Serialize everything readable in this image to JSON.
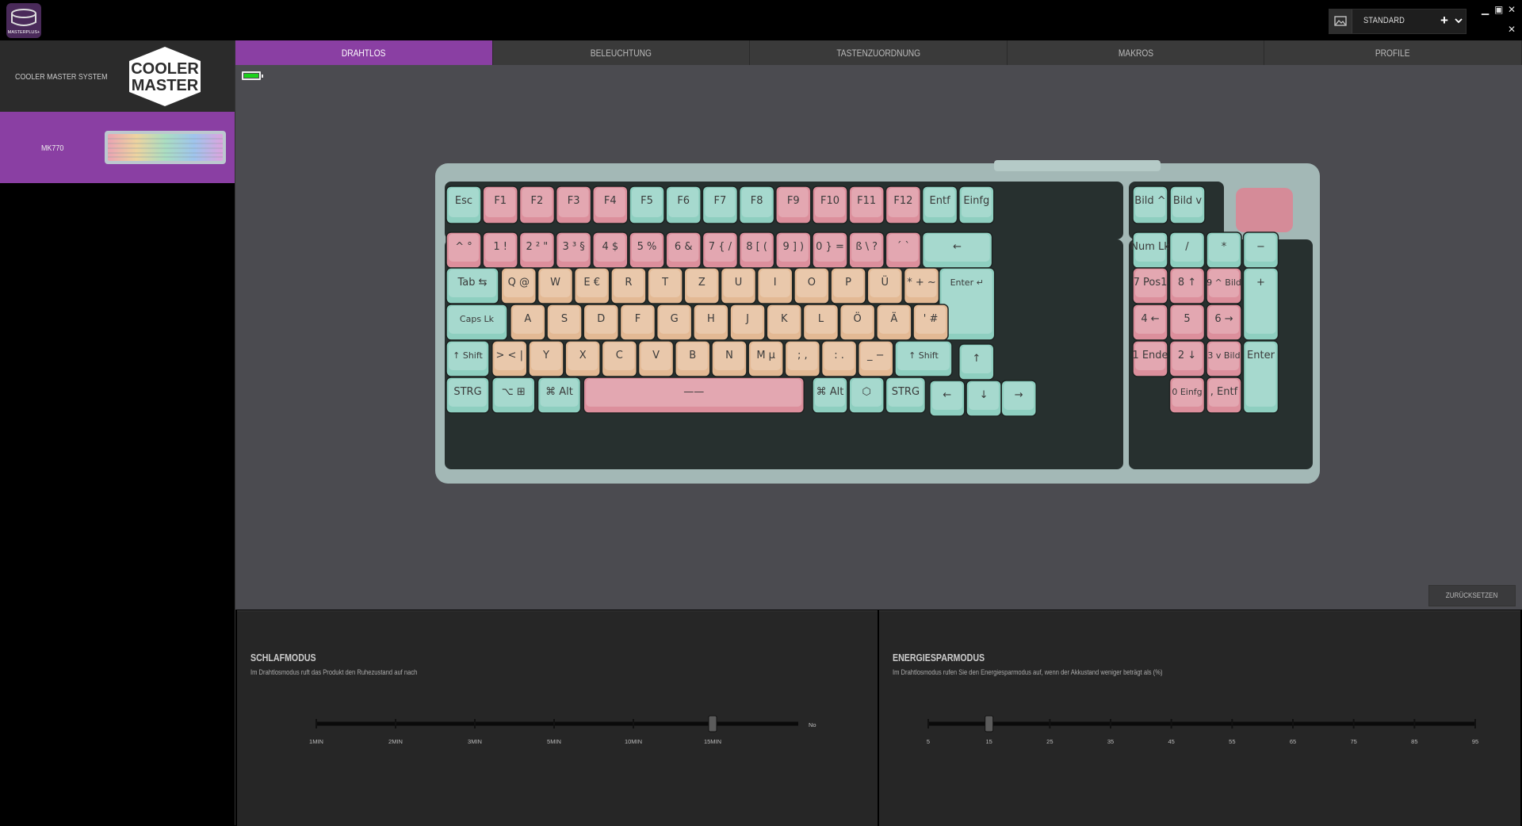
{
  "app": {
    "logo_text": "MASTERPLUS+",
    "profile": {
      "name": "STANDARD",
      "add_label": "+"
    },
    "window_controls": {
      "minimize": "▁",
      "maximize": "▣",
      "close": "✕",
      "exit": "✕"
    }
  },
  "sidebar": {
    "system_label": "COOLER MASTER SYSTEM",
    "logo_text": [
      "COOLER",
      "MASTER"
    ],
    "device_label": "MK770"
  },
  "tabs": [
    {
      "label": "DRAHTLOS",
      "active": true
    },
    {
      "label": "BELEUCHTUNG",
      "active": false
    },
    {
      "label": "TASTENZUORDNUNG",
      "active": false
    },
    {
      "label": "MAKROS",
      "active": false
    },
    {
      "label": "PROFILE",
      "active": false
    }
  ],
  "battery": {
    "level": 1.0,
    "color": "#1bd11b"
  },
  "keyboard": {
    "colors": {
      "green": "#8ecfc0",
      "pink": "#dc8f9c",
      "peach": "#e3b994",
      "frame": "#9fb6b3"
    },
    "rows": [
      [
        [
          "Esc",
          "green"
        ],
        [
          "F1",
          "pink"
        ],
        [
          "F2",
          "pink"
        ],
        [
          "F3",
          "pink"
        ],
        [
          "F4",
          "pink"
        ],
        [
          "F5",
          "green"
        ],
        [
          "F6",
          "green"
        ],
        [
          "F7",
          "green"
        ],
        [
          "F8",
          "green"
        ],
        [
          "F9",
          "pink"
        ],
        [
          "F10",
          "pink"
        ],
        [
          "F11",
          "pink"
        ],
        [
          "F12",
          "pink"
        ],
        [
          "Entf",
          "green"
        ],
        [
          "Einfg",
          "green"
        ],
        [
          "Bild ^",
          "green"
        ],
        [
          "Bild v",
          "green"
        ]
      ],
      [
        [
          "^ °",
          "pink"
        ],
        [
          "1 !",
          "pink"
        ],
        [
          "2 ² \"",
          "pink"
        ],
        [
          "3 ³ §",
          "pink"
        ],
        [
          "4 $",
          "pink"
        ],
        [
          "5 %",
          "pink"
        ],
        [
          "6 &",
          "pink"
        ],
        [
          "7 { /",
          "pink"
        ],
        [
          "8 [ (",
          "pink"
        ],
        [
          "9 ] )",
          "pink"
        ],
        [
          "0 } =",
          "pink"
        ],
        [
          "ß \\ ?",
          "pink"
        ],
        [
          "´ `",
          "pink"
        ],
        [
          "←",
          "green"
        ],
        [
          "Num Lk",
          "green"
        ],
        [
          "/",
          "green"
        ],
        [
          "*",
          "green"
        ],
        [
          "−",
          "green"
        ]
      ],
      [
        [
          "Tab ⇆",
          "green"
        ],
        [
          "Q @",
          "peach"
        ],
        [
          "W",
          "peach"
        ],
        [
          "E €",
          "peach"
        ],
        [
          "R",
          "peach"
        ],
        [
          "T",
          "peach"
        ],
        [
          "Z",
          "peach"
        ],
        [
          "U",
          "peach"
        ],
        [
          "I",
          "peach"
        ],
        [
          "O",
          "peach"
        ],
        [
          "P",
          "peach"
        ],
        [
          "Ü",
          "peach"
        ],
        [
          "* + ~",
          "peach"
        ],
        [
          "Enter ↵",
          "green"
        ],
        [
          "7 Pos1",
          "pink"
        ],
        [
          "8 ↑",
          "pink"
        ],
        [
          "9 ^ Bild",
          "pink"
        ],
        [
          "+",
          "green"
        ]
      ],
      [
        [
          "Caps Lk",
          "green"
        ],
        [
          "A",
          "peach"
        ],
        [
          "S",
          "peach"
        ],
        [
          "D",
          "peach"
        ],
        [
          "F",
          "peach"
        ],
        [
          "G",
          "peach"
        ],
        [
          "H",
          "peach"
        ],
        [
          "J",
          "peach"
        ],
        [
          "K",
          "peach"
        ],
        [
          "L",
          "peach"
        ],
        [
          "Ö",
          "peach"
        ],
        [
          "Ä",
          "peach"
        ],
        [
          "' #",
          "peach"
        ],
        [
          "4 ←",
          "pink"
        ],
        [
          "5",
          "pink"
        ],
        [
          "6 →",
          "pink"
        ]
      ],
      [
        [
          "↑ Shift",
          "green"
        ],
        [
          "> < |",
          "peach"
        ],
        [
          "Y",
          "peach"
        ],
        [
          "X",
          "peach"
        ],
        [
          "C",
          "peach"
        ],
        [
          "V",
          "peach"
        ],
        [
          "B",
          "peach"
        ],
        [
          "N",
          "peach"
        ],
        [
          "M µ",
          "peach"
        ],
        [
          "; ,",
          "peach"
        ],
        [
          ": .",
          "peach"
        ],
        [
          "_ −",
          "peach"
        ],
        [
          "↑ Shift",
          "green"
        ],
        [
          "↑",
          "green"
        ],
        [
          "1 Ende",
          "pink"
        ],
        [
          "2 ↓",
          "pink"
        ],
        [
          "3 v Bild",
          "pink"
        ],
        [
          "Enter",
          "green"
        ]
      ],
      [
        [
          "STRG",
          "green"
        ],
        [
          "⌥ ⊞",
          "green"
        ],
        [
          "⌘ Alt",
          "green"
        ],
        [
          "——",
          "pink"
        ],
        [
          "⌘ Alt",
          "green"
        ],
        [
          "⬡",
          "green"
        ],
        [
          "STRG",
          "green"
        ],
        [
          "←",
          "green"
        ],
        [
          "↓",
          "green"
        ],
        [
          "→",
          "green"
        ],
        [
          "0 Einfg",
          "pink"
        ],
        [
          ", Entf",
          "pink"
        ]
      ]
    ]
  },
  "reset_label": "ZURÜCKSETZEN",
  "sleep": {
    "title": "SCHLAFMODUS",
    "description": "Im Drahtlosmodus ruft das Produkt den Ruhezustand auf nach",
    "ticks": [
      "1MIN",
      "2MIN",
      "3MIN",
      "5MIN",
      "10MIN",
      "15MIN"
    ],
    "end_label": "No",
    "value": "15MIN"
  },
  "energy": {
    "title": "ENERGIESPARMODUS",
    "description": "Im Drahtlosmodus rufen Sie den Energiesparmodus auf, wenn der Akkustand weniger beträgt als (%)",
    "ticks": [
      "5",
      "15",
      "25",
      "35",
      "45",
      "55",
      "65",
      "75",
      "85",
      "95"
    ],
    "value": "15"
  }
}
